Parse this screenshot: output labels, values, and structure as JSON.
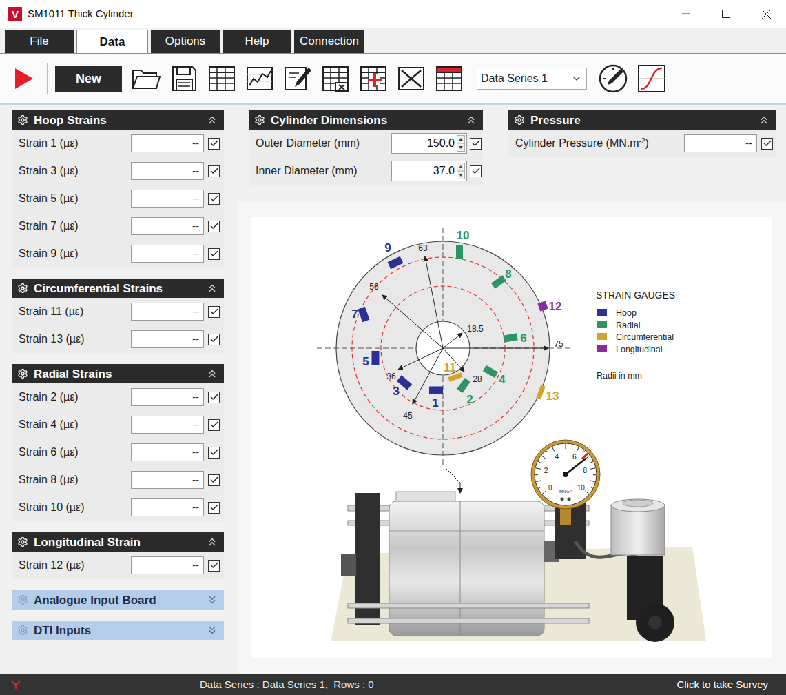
{
  "window": {
    "title": "SM1011 Thick Cylinder",
    "logo": "V"
  },
  "tabs": [
    {
      "label": "File",
      "selected": false
    },
    {
      "label": "Data",
      "selected": true
    },
    {
      "label": "Options",
      "selected": false
    },
    {
      "label": "Help",
      "selected": false
    },
    {
      "label": "Connection",
      "selected": false
    }
  ],
  "toolbar": {
    "new_button": "New",
    "series_select": "Data Series 1"
  },
  "sections": [
    {
      "title": "Hoop Strains",
      "expanded": true,
      "rows": [
        {
          "label": "Strain 1 (µε)",
          "value": "--",
          "checked": true
        },
        {
          "label": "Strain 3 (µε)",
          "value": "--",
          "checked": true
        },
        {
          "label": "Strain 5 (µε)",
          "value": "--",
          "checked": true
        },
        {
          "label": "Strain 7 (µε)",
          "value": "--",
          "checked": true
        },
        {
          "label": "Strain 9 (µε)",
          "value": "--",
          "checked": true
        }
      ]
    },
    {
      "title": "Circumferential Strains",
      "expanded": true,
      "rows": [
        {
          "label": "Strain 11 (µε)",
          "value": "--",
          "checked": true
        },
        {
          "label": "Strain 13 (µε)",
          "value": "--",
          "checked": true
        }
      ]
    },
    {
      "title": "Radial Strains",
      "expanded": true,
      "rows": [
        {
          "label": "Strain 2 (µε)",
          "value": "--",
          "checked": true
        },
        {
          "label": "Strain 4 (µε)",
          "value": "--",
          "checked": true
        },
        {
          "label": "Strain 6 (µε)",
          "value": "--",
          "checked": true
        },
        {
          "label": "Strain 8 (µε)",
          "value": "--",
          "checked": true
        },
        {
          "label": "Strain 10 (µε)",
          "value": "--",
          "checked": true
        }
      ]
    },
    {
      "title": "Longitudinal Strain",
      "expanded": true,
      "rows": [
        {
          "label": "Strain 12 (µε)",
          "value": "--",
          "checked": true
        }
      ]
    },
    {
      "title": "Analogue Input Board",
      "expanded": false,
      "rows": []
    },
    {
      "title": "DTI Inputs",
      "expanded": false,
      "rows": []
    }
  ],
  "dimensions": {
    "title": "Cylinder Dimensions",
    "expanded": true,
    "rows": [
      {
        "label": "Outer Diameter (mm)",
        "value": "150.0",
        "checked": true
      },
      {
        "label": "Inner Diameter (mm)",
        "value": "37.0",
        "checked": true
      }
    ]
  },
  "pressure": {
    "title": "Pressure",
    "expanded": true,
    "rows": [
      {
        "label": "Cylinder Pressure (MN.m",
        "superscript": "-2",
        "label_end": ")",
        "value": "--",
        "checked": true
      }
    ]
  },
  "diagram": {
    "gauges": [
      {
        "number": "1",
        "type": "Hoop"
      },
      {
        "number": "2",
        "type": "Radial"
      },
      {
        "number": "3",
        "type": "Hoop"
      },
      {
        "number": "4",
        "type": "Radial"
      },
      {
        "number": "5",
        "type": "Hoop"
      },
      {
        "number": "6",
        "type": "Radial"
      },
      {
        "number": "7",
        "type": "Hoop"
      },
      {
        "number": "8",
        "type": "Radial"
      },
      {
        "number": "9",
        "type": "Hoop"
      },
      {
        "number": "10",
        "type": "Radial"
      },
      {
        "number": "11",
        "type": "Circumferential"
      },
      {
        "number": "12",
        "type": "Longitudinal"
      },
      {
        "number": "13",
        "type": "Circumferential"
      }
    ],
    "radii": [
      "63",
      "56",
      "18.5",
      "75",
      "28",
      "36",
      "45"
    ],
    "legend": {
      "title": "STRAIN GAUGES",
      "items": [
        {
          "label": "Hoop",
          "color": "#2b3192"
        },
        {
          "label": "Radial",
          "color": "#2f9463"
        },
        {
          "label": "Circumferential",
          "color": "#d6a22a"
        },
        {
          "label": "Longitudinal",
          "color": "#8e2aa0"
        }
      ],
      "note": "Radii in mm"
    },
    "pressure_gauge": {
      "ticks": [
        "0",
        "2",
        "4",
        "6",
        "8",
        "10"
      ],
      "unit": "MN/m²",
      "level": 0.7
    }
  },
  "status_bar": {
    "text": "Data Series : Data Series 1,  Rows : 0",
    "link": "Click to take Survey"
  }
}
